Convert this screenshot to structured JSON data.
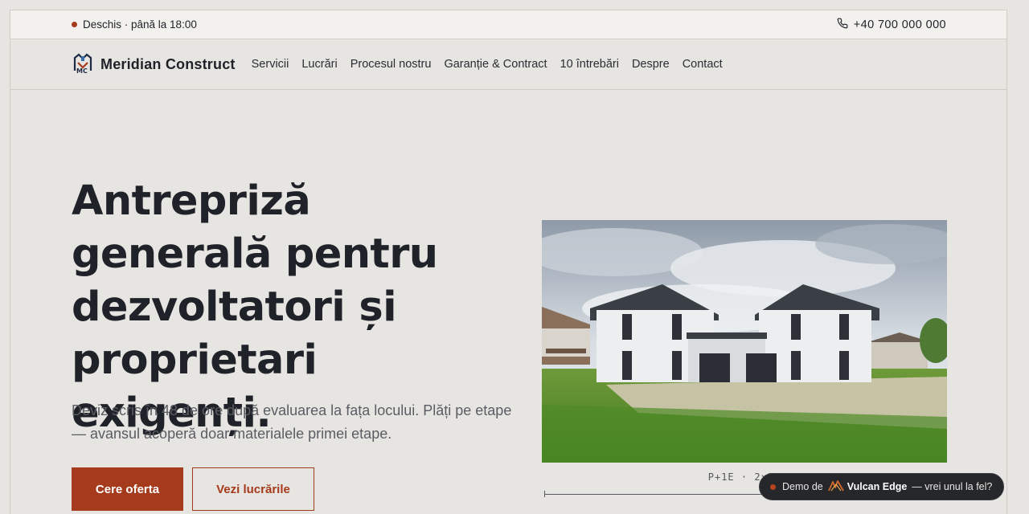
{
  "topbar": {
    "status": "Deschis · până la 18:00",
    "phone": "+40 700 000 000"
  },
  "brand": {
    "name": "Meridian Construct"
  },
  "nav": {
    "items": [
      "Servicii",
      "Lucrări",
      "Procesul nostru",
      "Garanție & Contract",
      "10 întrebări",
      "Despre",
      "Contact"
    ]
  },
  "hero": {
    "title": "Antrepriză generală pentru dezvoltatori și proprietari exigenți.",
    "subtitle": "Deviz scris în 48 de ore după evaluarea la fața locului. Plăți pe etape — avansul acoperă doar materialele primei etape.",
    "cta_primary": "Cere oferta",
    "cta_secondary": "Vezi lucrările",
    "image_caption": "P+1E · 2×21"
  },
  "demo_badge": {
    "prefix": "Demo de",
    "brand": "Vulcan Edge",
    "suffix": "— vrei unul la fel?"
  },
  "colors": {
    "accent": "#a63a1c",
    "background": "#e7e5e1",
    "text": "#1f2228"
  },
  "icons": {
    "status": "status-dot",
    "phone": "phone-icon",
    "logo": "meridian-logo",
    "demo_logo": "vulcan-edge-logo"
  }
}
